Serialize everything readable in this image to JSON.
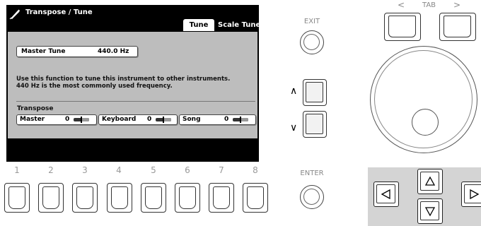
{
  "screen": {
    "title": "Transpose / Tune",
    "tabs": [
      {
        "label": "Tune",
        "active": true
      },
      {
        "label": "Scale Tune",
        "active": false
      }
    ],
    "master_tune": {
      "label": "Master Tune",
      "value": "440.0 Hz"
    },
    "description": [
      "Use this function to tune this instrument to other instruments.",
      "440 Hz is the most commonly used frequency."
    ],
    "transpose": {
      "heading": "Transpose",
      "fields": [
        {
          "label": "Master",
          "value": "0"
        },
        {
          "label": "Keyboard",
          "value": "0"
        },
        {
          "label": "Song",
          "value": "0"
        }
      ]
    }
  },
  "number_buttons": [
    "1",
    "2",
    "3",
    "4",
    "5",
    "6",
    "7",
    "8"
  ],
  "controls": {
    "exit_label": "EXIT",
    "enter_label": "ENTER",
    "tab_label": "TAB",
    "tab_left_symbol": "<",
    "tab_right_symbol": ">",
    "up_symbol": "∧",
    "down_symbol": "∨"
  },
  "icons": {
    "title_icon": "pen-icon",
    "dpad": [
      "up-arrow-icon",
      "left-arrow-icon",
      "right-arrow-icon",
      "down-arrow-icon"
    ]
  },
  "colors": {
    "lcd_background": "#000000",
    "panel_background": "#bdbdbd",
    "dpad_background": "#d4d4d4"
  }
}
